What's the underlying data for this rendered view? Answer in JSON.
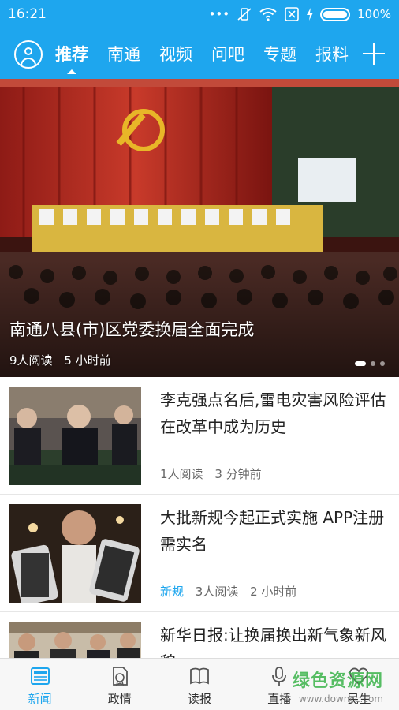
{
  "status_bar": {
    "time": "16:21",
    "battery": "100%"
  },
  "nav": {
    "tabs": [
      {
        "label": "推荐",
        "active": true
      },
      {
        "label": "南通"
      },
      {
        "label": "视频"
      },
      {
        "label": "问吧"
      },
      {
        "label": "专题"
      },
      {
        "label": "报料"
      }
    ]
  },
  "hero": {
    "title": "南通八县(市)区党委换届全面完成",
    "reads": "9人阅读",
    "time": "5 小时前"
  },
  "articles": [
    {
      "title": "李克强点名后,雷电灾害风险评估在改革中成为历史",
      "reads": "1人阅读",
      "time": "3 分钟前",
      "tag": ""
    },
    {
      "title": "大批新规今起正式实施 APP注册需实名",
      "reads": "3人阅读",
      "time": "2 小时前",
      "tag": "新规"
    },
    {
      "title": "新华日报:让换届换出新气象新风貌",
      "reads": "",
      "time": "",
      "tag": ""
    }
  ],
  "bottom_nav": [
    {
      "label": "新闻",
      "icon": "newspaper-icon",
      "active": true
    },
    {
      "label": "政情",
      "icon": "document-badge-icon"
    },
    {
      "label": "读报",
      "icon": "open-paper-icon"
    },
    {
      "label": "直播",
      "icon": "microphone-icon"
    },
    {
      "label": "民生",
      "icon": "heart-icon"
    }
  ],
  "watermark": {
    "line1": "绿色资源网",
    "line2": "www.downcc.com"
  },
  "colors": {
    "accent": "#1ea6ee",
    "watermark": "#3bb34a"
  }
}
